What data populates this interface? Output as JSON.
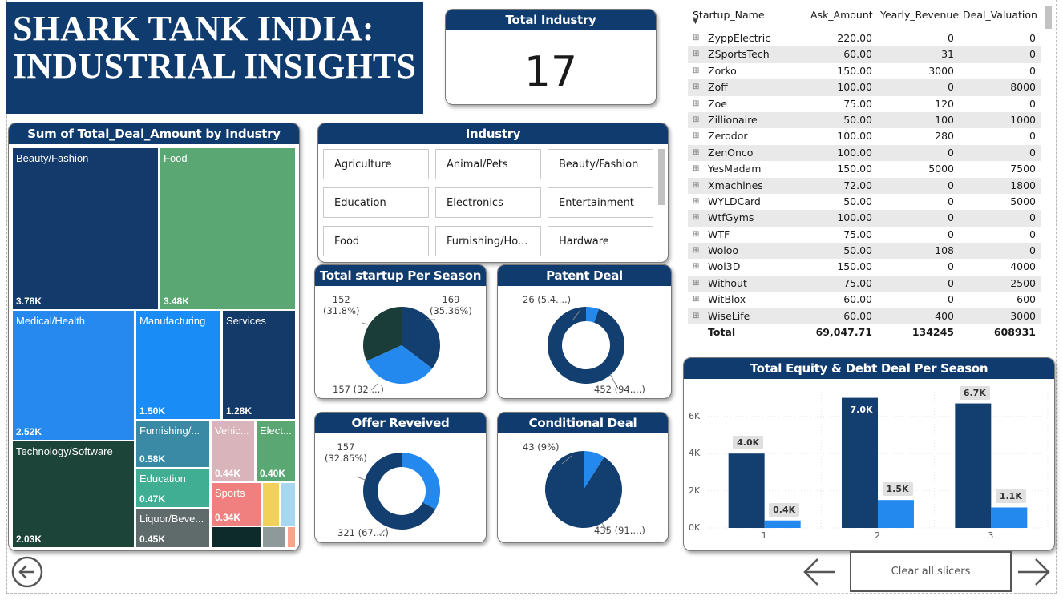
{
  "report_title": "SHARK TANK INDIA: INDUSTRIAL INSIGHTS",
  "kpi": {
    "title": "Total Industry",
    "value": "17"
  },
  "treemap": {
    "title": "Sum of Total_Deal_Amount by Industry",
    "cells": [
      {
        "label": "Beauty/Fashion",
        "value": "3.78K",
        "color": "#133a6b"
      },
      {
        "label": "Food",
        "value": "3.48K",
        "color": "#5ba774"
      },
      {
        "label": "Medical/Health",
        "value": "2.52K",
        "color": "#2689f0"
      },
      {
        "label": "Manufacturing",
        "value": "1.50K",
        "color": "#1a8cf5"
      },
      {
        "label": "Services",
        "value": "1.28K",
        "color": "#143a6a"
      },
      {
        "label": "Technology/Software",
        "value": "2.03K",
        "color": "#1d4439"
      },
      {
        "label": "Furnishing/...",
        "value": "0.58K",
        "color": "#3a8aa6"
      },
      {
        "label": "Vehic...",
        "value": "0.44K",
        "color": "#d9b4bb"
      },
      {
        "label": "Elect...",
        "value": "0.40K",
        "color": "#5ba774"
      },
      {
        "label": "Education",
        "value": "0.47K",
        "color": "#3fae93"
      },
      {
        "label": "Sports",
        "value": "0.34K",
        "color": "#f08080"
      },
      {
        "label": "Liquor/Beve...",
        "value": "0.45K",
        "color": "#5f6a6a"
      }
    ]
  },
  "industry_slicer": {
    "title": "Industry",
    "options": [
      "Agriculture",
      "Animal/Pets",
      "Beauty/Fashion",
      "Education",
      "Electronics",
      "Entertainment",
      "Food",
      "Furnishing/Ho...",
      "Hardware"
    ]
  },
  "season_pie": {
    "title": "Total startup Per Season",
    "slices": [
      {
        "label": "169\n(35.36%)",
        "value": 35.36,
        "color": "#123f70"
      },
      {
        "label": "157 (32....)",
        "value": 32.85,
        "color": "#2489ef"
      },
      {
        "label": "152\n(31.8%)",
        "value": 31.8,
        "color": "#1a3d3a"
      }
    ]
  },
  "patent_donut": {
    "title": "Patent Deal",
    "slices": [
      {
        "label": "26 (5.4....)",
        "value": 5.44,
        "color": "#2489ef"
      },
      {
        "label": "452 (94....)",
        "value": 94.56,
        "color": "#123f70"
      }
    ]
  },
  "offer_donut": {
    "title": "Offer Reveived",
    "slices": [
      {
        "label": "157\n(32.85%)",
        "value": 32.85,
        "color": "#2489ef"
      },
      {
        "label": "321 (67....)",
        "value": 67.15,
        "color": "#123f70"
      }
    ]
  },
  "conditional_pie": {
    "title": "Conditional Deal",
    "slices": [
      {
        "label": "43 (9%)",
        "value": 9.0,
        "color": "#2489ef"
      },
      {
        "label": "435 (91....)",
        "value": 91.0,
        "color": "#123f70"
      }
    ]
  },
  "table": {
    "headers": [
      "Startup_Name",
      "Ask_Amount",
      "Yearly_Revenue",
      "Deal_Valuation"
    ],
    "rows": [
      [
        "ZyppElectric",
        "220.00",
        "0",
        "0"
      ],
      [
        "ZSportsTech",
        "60.00",
        "31",
        "0"
      ],
      [
        "Zorko",
        "150.00",
        "3000",
        "0"
      ],
      [
        "Zoff",
        "100.00",
        "0",
        "8000"
      ],
      [
        "Zoe",
        "75.00",
        "120",
        "0"
      ],
      [
        "Zillionaire",
        "50.00",
        "100",
        "1000"
      ],
      [
        "Zerodor",
        "100.00",
        "280",
        "0"
      ],
      [
        "ZenOnco",
        "100.00",
        "0",
        "0"
      ],
      [
        "YesMadam",
        "150.00",
        "5000",
        "7500"
      ],
      [
        "Xmachines",
        "72.00",
        "0",
        "1800"
      ],
      [
        "WYLDCard",
        "50.00",
        "0",
        "5000"
      ],
      [
        "WtfGyms",
        "100.00",
        "0",
        "0"
      ],
      [
        "WTF",
        "75.00",
        "0",
        "0"
      ],
      [
        "Woloo",
        "50.00",
        "108",
        "0"
      ],
      [
        "Wol3D",
        "150.00",
        "0",
        "4000"
      ],
      [
        "Without",
        "75.00",
        "0",
        "2500"
      ],
      [
        "WitBlox",
        "60.00",
        "0",
        "600"
      ],
      [
        "WiseLife",
        "60.00",
        "400",
        "3000"
      ]
    ],
    "total": [
      "Total",
      "69,047.71",
      "134245",
      "608931"
    ],
    "expand_icon": "plus-box-icon",
    "sort_icon": "sort-desc-icon"
  },
  "chart_data": {
    "type": "bar",
    "title": "Total Equity & Debt Deal Per Season",
    "categories": [
      "1",
      "2",
      "3"
    ],
    "series": [
      {
        "values": [
          4000,
          7000,
          6700
        ],
        "labels": [
          "4.0K",
          "7.0K",
          "6.7K"
        ],
        "color": "#123f70"
      },
      {
        "values": [
          400,
          1500,
          1100
        ],
        "labels": [
          "0.4K",
          "1.5K",
          "1.1K"
        ],
        "color": "#2489ef"
      }
    ],
    "y_ticks": [
      "0K",
      "2K",
      "4K",
      "6K"
    ],
    "ylim": [
      0,
      7500
    ],
    "grid": true
  },
  "nav": {
    "back_icon": "circle-arrow-left-icon",
    "prev_icon": "arrow-left-icon",
    "next_icon": "arrow-right-icon",
    "clear_label": "Clear all slicers"
  }
}
